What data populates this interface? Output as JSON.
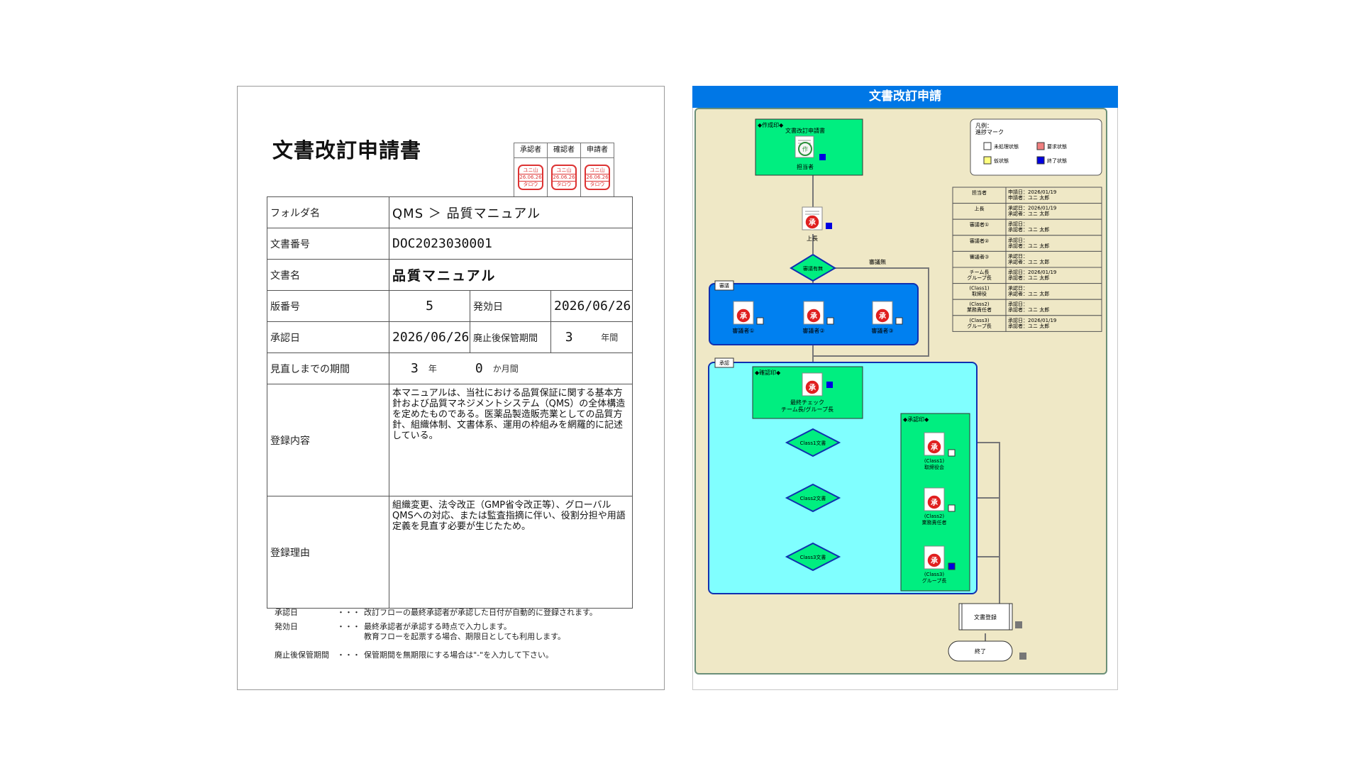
{
  "document": {
    "title": "文書改訂申請書",
    "stamps": {
      "headers": [
        "承認者",
        "確認者",
        "申請者"
      ],
      "stamp_text": [
        "ユニ山",
        "26.06.26",
        "タロウ"
      ]
    },
    "fields": {
      "folder_label": "フォルダ名",
      "folder_value": "QMS ＞ 品質マニュアル",
      "doc_number_label": "文書番号",
      "doc_number_value": "DOC2023030001",
      "doc_name_label": "文書名",
      "doc_name_value": "品質マニュアル",
      "version_label": "版番号",
      "version_value": "5",
      "effective_date_label": "発効日",
      "effective_date_value": "2026/06/26",
      "approval_date_label": "承認日",
      "approval_date_value": "2026/06/26",
      "retention_label": "廃止後保管期間",
      "retention_value": "3",
      "retention_unit": "年間",
      "review_period_label": "見直しまでの期間",
      "review_years": "3",
      "review_years_unit": "年",
      "review_months": "0",
      "review_months_unit": "か月間",
      "content_label": "登録内容",
      "content_text": "本マニュアルは、当社における品質保証に関する基本方針および品質マネジメントシステム（QMS）の全体構造を定めたものである。医薬品製造販売業としての品質方針、組織体制、文書体系、運用の枠組みを網羅的に記述している。",
      "reason_label": "登録理由",
      "reason_text": "組織変更、法令改正（GMP省令改正等）、グローバルQMSへの対応、または監査指摘に伴い、役割分担や用語定義を見直す必要が生じたため。"
    },
    "notes": [
      {
        "key": "承認日",
        "dots": "・・・",
        "text": "改訂フローの最終承認者が承認した日付が自動的に登録されます。"
      },
      {
        "key": "発効日",
        "dots": "・・・",
        "text": "最終承認者が承認する時点で入力します。"
      },
      {
        "key": "",
        "dots": "",
        "text": "教育フローを起票する場合、期限日としても利用します。"
      },
      {
        "key": "廃止後保管期間",
        "dots": "・・・",
        "text": "保管期間を無期限にする場合は\"-\"を入力して下さい。"
      }
    ]
  },
  "flow": {
    "title": "文書改訂申請",
    "legend": {
      "title": "凡例：",
      "subtitle": "進捗マーク",
      "items": [
        {
          "label": "未処理状態",
          "color": "#ffffff"
        },
        {
          "label": "要求状態",
          "color": "#f08080"
        },
        {
          "label": "仮状態",
          "color": "#ffff80"
        },
        {
          "label": "終了状態",
          "color": "#0000e0"
        }
      ]
    },
    "status_table": [
      {
        "role": "担当者",
        "lines": [
          "申請日：2026/01/19",
          "申請者：ユニ 太郎"
        ]
      },
      {
        "role": "上長",
        "lines": [
          "承認日：2026/01/19",
          "承認者：ユニ 太郎"
        ]
      },
      {
        "role": "審議者①",
        "lines": [
          "承認日：",
          "承認者：ユニ 太郎"
        ]
      },
      {
        "role": "審議者②",
        "lines": [
          "承認日：",
          "承認者：ユニ 太郎"
        ]
      },
      {
        "role": "審議者③",
        "lines": [
          "承認日：",
          "承認者：ユニ 太郎"
        ]
      },
      {
        "role": "チーム長\nグループ長",
        "lines": [
          "承認日：2026/01/19",
          "承認者：ユニ 太郎"
        ]
      },
      {
        "role": "(Class1)\n取締役",
        "lines": [
          "承認日：",
          "承認者：ユニ 太郎"
        ]
      },
      {
        "role": "(Class2)\n業務責任者",
        "lines": [
          "承認日：",
          "承認者：ユニ 太郎"
        ]
      },
      {
        "role": "(Class3)\nグループ長",
        "lines": [
          "承認日：2026/01/19",
          "承認者：ユニ 太郎"
        ]
      }
    ],
    "nodes": {
      "create_box": "◆作成印◆",
      "create_title": "文書改訂申請書",
      "create_person": "担当者",
      "boss": "上長",
      "review_decision": "審議有無",
      "review_none": "審議無",
      "review_group": "審議",
      "reviewers": [
        "審議者①",
        "審議者②",
        "審議者③"
      ],
      "approval_group": "承認",
      "confirm_box": "◆確認印◆",
      "confirm_title": "最終チェック",
      "confirm_person": "チーム長/グループ長",
      "approve_box": "◆承認印◆",
      "class1": "Class1文書",
      "class2": "Class2文書",
      "class3": "Class3文書",
      "approver1": [
        "(Class1)",
        "取締役会"
      ],
      "approver2": [
        "(Class2)",
        "業務責任者"
      ],
      "approver3": [
        "(Class3)",
        "グループ長"
      ],
      "register": "文書登録",
      "end": "終了",
      "seal_char": "承",
      "seal_char_create": "作"
    }
  }
}
